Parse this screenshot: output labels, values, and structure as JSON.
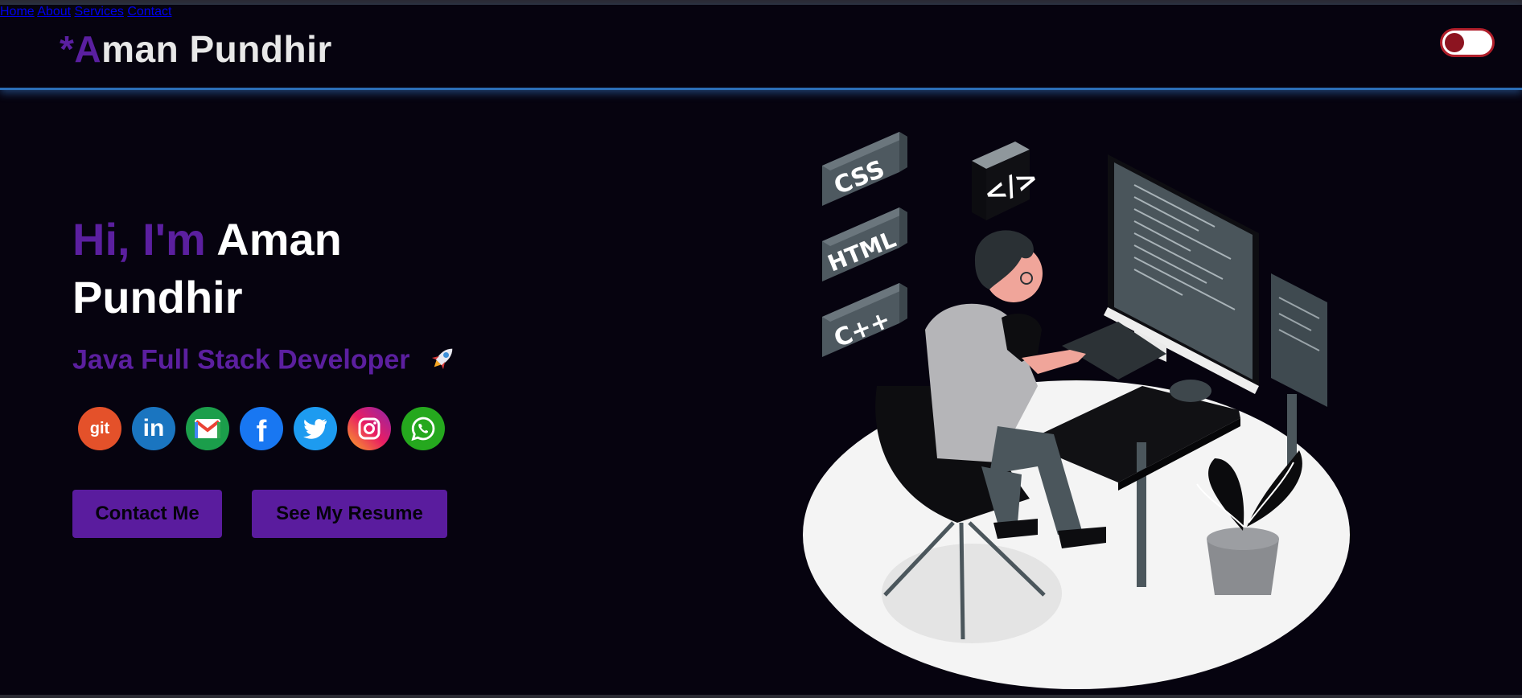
{
  "header": {
    "logo_prefix": "*",
    "logo_accent": "A",
    "logo_rest": "man Pundhir",
    "nav": [
      {
        "label": "Home"
      },
      {
        "label": "About"
      },
      {
        "label": "Services"
      },
      {
        "label": "Contact"
      }
    ],
    "theme_toggle": {
      "state": "off"
    }
  },
  "hero": {
    "greeting": "Hi, I'm",
    "name": "Aman Pundhir",
    "role": "Java Full Stack Developer",
    "role_emoji_icon": "rocket-icon",
    "socials": [
      {
        "icon": "git-icon",
        "text": "git",
        "color": "#e4512a"
      },
      {
        "icon": "linkedin-icon",
        "text": "in",
        "color": "#1a75c0"
      },
      {
        "icon": "gmail-icon",
        "color": "#1b9e4b"
      },
      {
        "icon": "facebook-icon",
        "text": "f",
        "color": "#1877f2"
      },
      {
        "icon": "twitter-icon",
        "color": "#1d9bf0"
      },
      {
        "icon": "instagram-icon",
        "color": "#d6249f"
      },
      {
        "icon": "whatsapp-icon",
        "color": "#25a81e"
      }
    ],
    "buttons": {
      "contact": "Contact Me",
      "resume": "See My Resume"
    }
  },
  "illustration": {
    "labels": {
      "css": "CSS",
      "html": "HTML",
      "cpp": "C++",
      "code": "</>"
    }
  },
  "colors": {
    "background": "#06030f",
    "accent": "#5b1f9f",
    "nav_glow": "#2c6fb8"
  }
}
